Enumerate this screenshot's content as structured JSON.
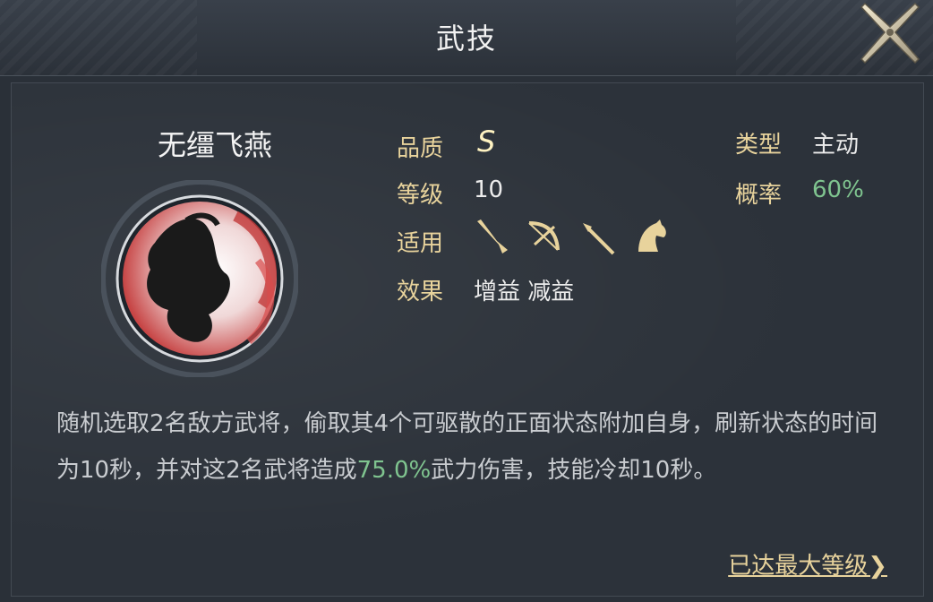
{
  "header": {
    "title": "武技"
  },
  "skill": {
    "name": "无缰飞燕",
    "quality_label": "品质",
    "quality_value": "S",
    "level_label": "等级",
    "level_value": "10",
    "applicable_label": "适用",
    "applicable_icons": [
      "sword-icon",
      "bow-icon",
      "spear-icon",
      "horse-icon"
    ],
    "effect_label": "效果",
    "effect_value": "增益 减益",
    "type_label": "类型",
    "type_value": "主动",
    "rate_label": "概率",
    "rate_value": "60%"
  },
  "description": {
    "part1": "随机选取2名敌方武将，偷取其4个可驱散的正面状态附加自身，刷新状态的时间为10秒，并对这2名武将造成",
    "highlight": "75.0%",
    "part2": "武力伤害，技能冷却10秒。"
  },
  "footer": {
    "max_level_label": "已达最大等级❯"
  },
  "colors": {
    "gold": "#e8d39c",
    "green": "#7fc48f",
    "background": "#2c323a"
  }
}
